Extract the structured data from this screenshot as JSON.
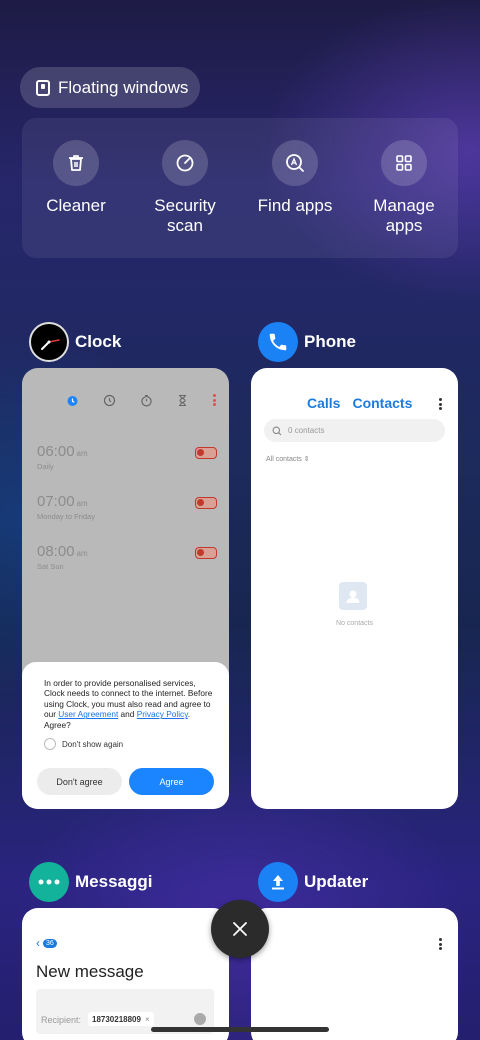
{
  "floating_windows": {
    "label": "Floating windows"
  },
  "quick_actions": [
    {
      "label": "Cleaner",
      "icon": "trash-icon"
    },
    {
      "label": "Security\nscan",
      "icon": "security-scan-icon"
    },
    {
      "label": "Find apps",
      "icon": "find-apps-icon"
    },
    {
      "label": "Manage\napps",
      "icon": "grid-icon"
    }
  ],
  "apps": {
    "clock": {
      "name": "Clock",
      "alarms": [
        {
          "time": "06:00",
          "ampm": "am",
          "repeat": "Daily"
        },
        {
          "time": "07:00",
          "ampm": "am",
          "repeat": "Monday to Friday"
        },
        {
          "time": "08:00",
          "ampm": "am",
          "repeat": "Sat Sun"
        }
      ],
      "dialog": {
        "text_before": "In order to provide personalised services, Clock needs to connect to the internet. Before using Clock, you must also read and agree to our ",
        "link1": "User Agreement",
        "text_and": " and ",
        "link2": "Privacy Policy",
        "text_after": ". Agree?",
        "checkbox": "Don't show again",
        "disagree": "Don't agree",
        "agree": "Agree"
      }
    },
    "phone": {
      "name": "Phone",
      "tab_calls": "Calls",
      "tab_contacts": "Contacts",
      "search_placeholder": "0 contacts",
      "filter": "All contacts",
      "empty": "No contacts"
    },
    "messaggi": {
      "name": "Messaggi",
      "badge": "36",
      "title": "New message",
      "recipient_label": "Recipient:",
      "recipient": "18730218809"
    },
    "updater": {
      "name": "Updater"
    }
  },
  "colors": {
    "accent_blue": "#1b84ff",
    "clock_icon": "#000000",
    "messaggi_icon": "#12b39a",
    "phone_icon": "#1a82f5"
  }
}
